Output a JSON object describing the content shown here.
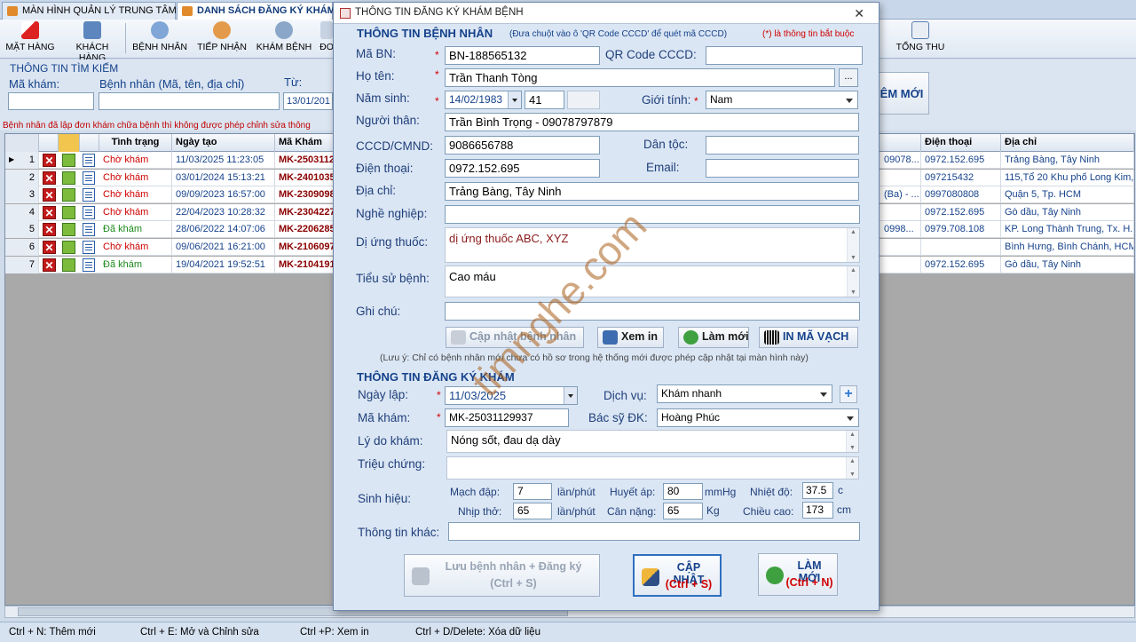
{
  "tabs": [
    {
      "label": "MÀN HÌNH QUẢN LÝ TRUNG TÂM"
    },
    {
      "label": "DANH SÁCH ĐĂNG KÝ KHÁM"
    }
  ],
  "toolbar": {
    "mat_hang": "MẶT HÀNG",
    "khach_hang": "KHÁCH HÀNG",
    "benh_nhan": "BỆNH NHÂN",
    "tiep_nhan": "TIẾP NHẬN",
    "kham_benh": "KHÁM BỆNH",
    "do": "ĐO",
    "tong_thu": "TỔNG THU"
  },
  "search": {
    "title": "THÔNG TIN TÌM KIẾM",
    "ma_kham_label": "Mã khám:",
    "benh_nhan_label": "Bệnh nhân (Mã, tên, địa chỉ)",
    "tu_label": "Từ:",
    "tu_value": "13/01/201",
    "them_moi": "ÊM MỚI"
  },
  "warning": "Bệnh nhân đã lập đơn khám chữa bệnh thì không được phép chỉnh sửa thông",
  "grid": {
    "headers": {
      "tinh_trang": "Tình trạng",
      "ngay_tao": "Ngày tạo",
      "ma_kham": "Mã Khám",
      "dien_thoai": "Điện thoại",
      "dia_chi": "Địa chỉ"
    },
    "rows": [
      {
        "n": "1",
        "status": "Chờ khám",
        "date": "11/03/2025 11:23:05",
        "code": "MK-2503112",
        "extra": "09078...",
        "phone": "0972.152.695",
        "addr": "Trảng Bàng, Tây Ninh"
      },
      {
        "n": "2",
        "status": "Chờ khám",
        "date": "03/01/2024 15:13:21",
        "code": "MK-2401035",
        "extra": "",
        "phone": "097215432",
        "addr": "115,Tổ 20 Khu phố Long Kim,..."
      },
      {
        "n": "3",
        "status": "Chờ khám",
        "date": "09/09/2023 16:57:00",
        "code": "MK-2309098",
        "extra": "(Ba) - ...",
        "phone": "0997080808",
        "addr": "Quận 5, Tp. HCM"
      },
      {
        "n": "4",
        "status": "Chờ khám",
        "date": "22/04/2023 10:28:32",
        "code": "MK-2304227",
        "extra": "",
        "phone": "0972.152.695",
        "addr": "Gò dầu, Tây Ninh"
      },
      {
        "n": "5",
        "status": "Đã khám",
        "date": "28/06/2022 14:07:06",
        "code": "MK-2206285",
        "extra": "0998...",
        "phone": "0979.708.108",
        "addr": "KP. Long Thành Trung, Tx. H..."
      },
      {
        "n": "6",
        "status": "Chờ khám",
        "date": "09/06/2021 16:21:00",
        "code": "MK-2106097",
        "extra": "",
        "phone": "",
        "addr": "Bình Hưng, Bình Chánh, HCM"
      },
      {
        "n": "7",
        "status": "Đã khám",
        "date": "19/04/2021 19:52:51",
        "code": "MK-2104191",
        "extra": "",
        "phone": "0972.152.695",
        "addr": "Gò dầu, Tây Ninh"
      }
    ]
  },
  "statusbar": {
    "s1": "Ctrl + N: Thêm mới",
    "s2": "Ctrl + E: Mở và Chỉnh sửa",
    "s3": "Ctrl +P: Xem in",
    "s4": "Ctrl + D/Delete: Xóa dữ liệu"
  },
  "dialog": {
    "title": "THÔNG TIN ĐĂNG KÝ KHÁM BỆNH",
    "sec1": "THÔNG TIN BỆNH NHÂN",
    "sec1_hint": "(Đưa chuột vào ô 'QR Code CCCD' để quét mã CCCD)",
    "required_note": "(*) là thông tin bắt buộc",
    "labels": {
      "ma_bn": "Mã BN:",
      "qr": "QR Code CCCD:",
      "ho_ten": "Họ tên:",
      "nam_sinh": "Năm sinh:",
      "gioi_tinh": "Giới tính:",
      "nguoi_than": "Người thân:",
      "cccd": "CCCD/CMND:",
      "dan_toc": "Dân tộc:",
      "dien_thoai": "Điện thoại:",
      "email": "Email:",
      "dia_chi": "Địa chỉ:",
      "nghe_nghiep": "Nghề nghiệp:",
      "di_ung": "Dị ứng thuốc:",
      "tieu_su": "Tiểu sử bệnh:",
      "ghi_chu": "Ghi chú:"
    },
    "values": {
      "ma_bn": "BN-188565132",
      "ho_ten": "Trần Thanh Tòng",
      "nam_sinh": "14/02/1983",
      "tuoi": "41",
      "gioi_tinh": "Nam",
      "nguoi_than": "Trần Bình Trọng - 09078797879",
      "cccd": "9086656788",
      "dien_thoai": "0972.152.695",
      "dia_chi": "Trảng Bàng, Tây Ninh",
      "di_ung": "dị ứng thuốc ABC, XYZ",
      "tieu_su": "Cao máu"
    },
    "buttons": {
      "cap_nhat_bn": "Cập nhật bệnh nhân",
      "xem_in": "Xem in",
      "lam_moi": "Làm mới",
      "in_ma_vach": "IN MÃ VẠCH",
      "browse": "..."
    },
    "note": "(Lưu ý: Chỉ có bệnh nhân mới chưa có hồ sơ trong hệ thống mới được phép cập nhật tại màn hình này)",
    "sec2": "THÔNG TIN ĐĂNG KÝ KHÁM",
    "labels2": {
      "ngay_lap": "Ngày lập:",
      "dich_vu": "Dịch vụ:",
      "ma_kham": "Mã khám:",
      "bac_sy": "Bác sỹ ĐK:",
      "ly_do": "Lý do khám:",
      "trieu_chung": "Triệu chứng:",
      "sinh_hieu": "Sinh hiệu:",
      "mach": "Mạch đập:",
      "nhip_tho": "Nhịp thở:",
      "huyet_ap": "Huyết áp:",
      "can_nang": "Cân nặng:",
      "nhiet_do": "Nhiệt độ:",
      "chieu_cao": "Chiều cao:",
      "thong_tin_khac": "Thông tin khác:",
      "u_lan1": "lần/phút",
      "u_lan2": "lần/phút",
      "u_mmhg": "mmHg",
      "u_kg": "Kg",
      "u_c": "c",
      "u_cm": "cm"
    },
    "values2": {
      "ngay_lap": "11/03/2025",
      "dich_vu": "Khám nhanh",
      "ma_kham": "MK-25031129937",
      "bac_sy": "Hoàng Phúc",
      "ly_do": "Nóng sốt, đau dạ dày",
      "mach": "7",
      "nhip_tho": "65",
      "huyet_ap": "80",
      "can_nang": "65",
      "nhiet_do": "37.5",
      "chieu_cao": "173"
    },
    "bottom": {
      "luu_1": "Lưu bệnh nhân + Đăng ký",
      "luu_2": "(Ctrl + S)",
      "cap_1": "CẬP NHẬT",
      "cap_2": "(Ctrl + S)",
      "moi_1": "LÀM MỚI",
      "moi_2": "(Ctrl + N)"
    }
  },
  "watermark": "timnghe.com",
  "colors": {
    "accent": "#15428b",
    "required": "#d00000",
    "waiting": "#d00000",
    "done": "#1a8a1a",
    "code": "#8b0000"
  }
}
